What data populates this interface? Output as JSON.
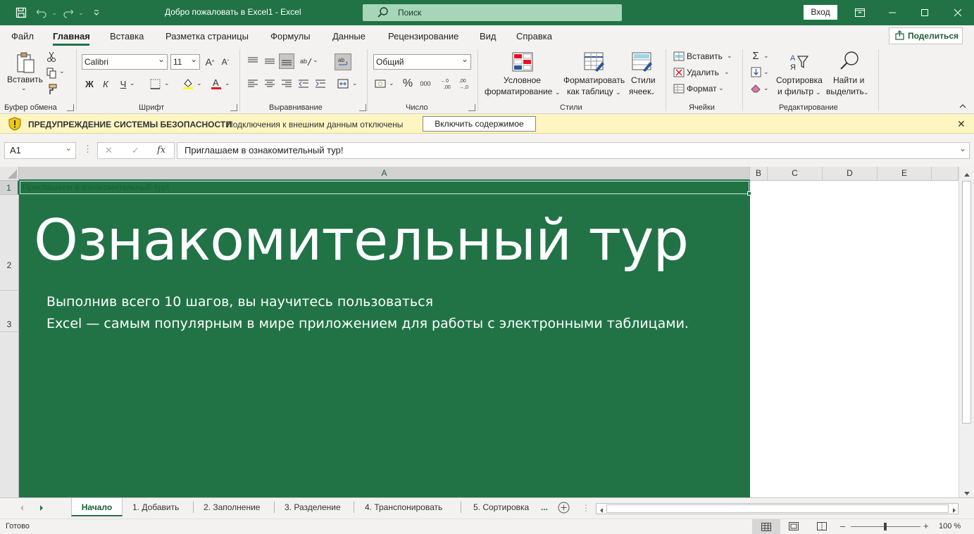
{
  "titlebar": {
    "doc_title": "Добро пожаловать в Excel1  -  Excel",
    "search_placeholder": "Поиск",
    "login_label": "Вход",
    "accent": "#217346"
  },
  "menu": {
    "items": [
      "Файл",
      "Главная",
      "Вставка",
      "Разметка страницы",
      "Формулы",
      "Данные",
      "Рецензирование",
      "Вид",
      "Справка"
    ],
    "active": "Главная",
    "share_label": "Поделиться"
  },
  "ribbon": {
    "clipboard": {
      "paste_label": "Вставить",
      "group": "Буфер обмена"
    },
    "font": {
      "font_name": "Calibri",
      "font_size": "11",
      "bold": "Ж",
      "italic": "К",
      "underline": "Ч",
      "group": "Шрифт"
    },
    "alignment": {
      "group": "Выравнивание"
    },
    "number": {
      "format": "Общий",
      "group": "Число"
    },
    "styles": {
      "conditional_l1": "Условное",
      "conditional_l2": "форматирование",
      "format_table_l1": "Форматировать",
      "format_table_l2": "как таблицу",
      "cell_styles_l1": "Стили",
      "cell_styles_l2": "ячеек",
      "group": "Стили"
    },
    "cells": {
      "insert": "Вставить",
      "delete": "Удалить",
      "format": "Формат",
      "group": "Ячейки"
    },
    "editing": {
      "sort_l1": "Сортировка",
      "sort_l2": "и фильтр",
      "find_l1": "Найти и",
      "find_l2": "выделить",
      "group": "Редактирование"
    }
  },
  "security": {
    "title": "ПРЕДУПРЕЖДЕНИЕ СИСТЕМЫ БЕЗОПАСНОСТИ",
    "message": "Подключения к внешним данным отключены",
    "button": "Включить содержимое"
  },
  "formula_bar": {
    "name_box": "A1",
    "content": "Приглашаем в ознакомительный тур!"
  },
  "grid": {
    "columns": [
      "A",
      "B",
      "C",
      "D",
      "E"
    ],
    "rows": [
      "1",
      "2",
      "3"
    ],
    "a1_text": "Приглашаем в ознакомительный тур!",
    "title": "Ознакомительный тур",
    "subtitle_line1": "Выполнив всего 10 шагов, вы научитесь пользоваться",
    "subtitle_line2": "Excel — самым популярным в мире приложением для работы с электронными таблицами."
  },
  "tabs": {
    "items": [
      "Начало",
      "1. Добавить",
      "2. Заполнение",
      "3. Разделение",
      "4. Транспонировать",
      "5. Сортировка"
    ],
    "more": "...",
    "active": "Начало"
  },
  "status": {
    "state": "Готово",
    "zoom": "100 %"
  }
}
